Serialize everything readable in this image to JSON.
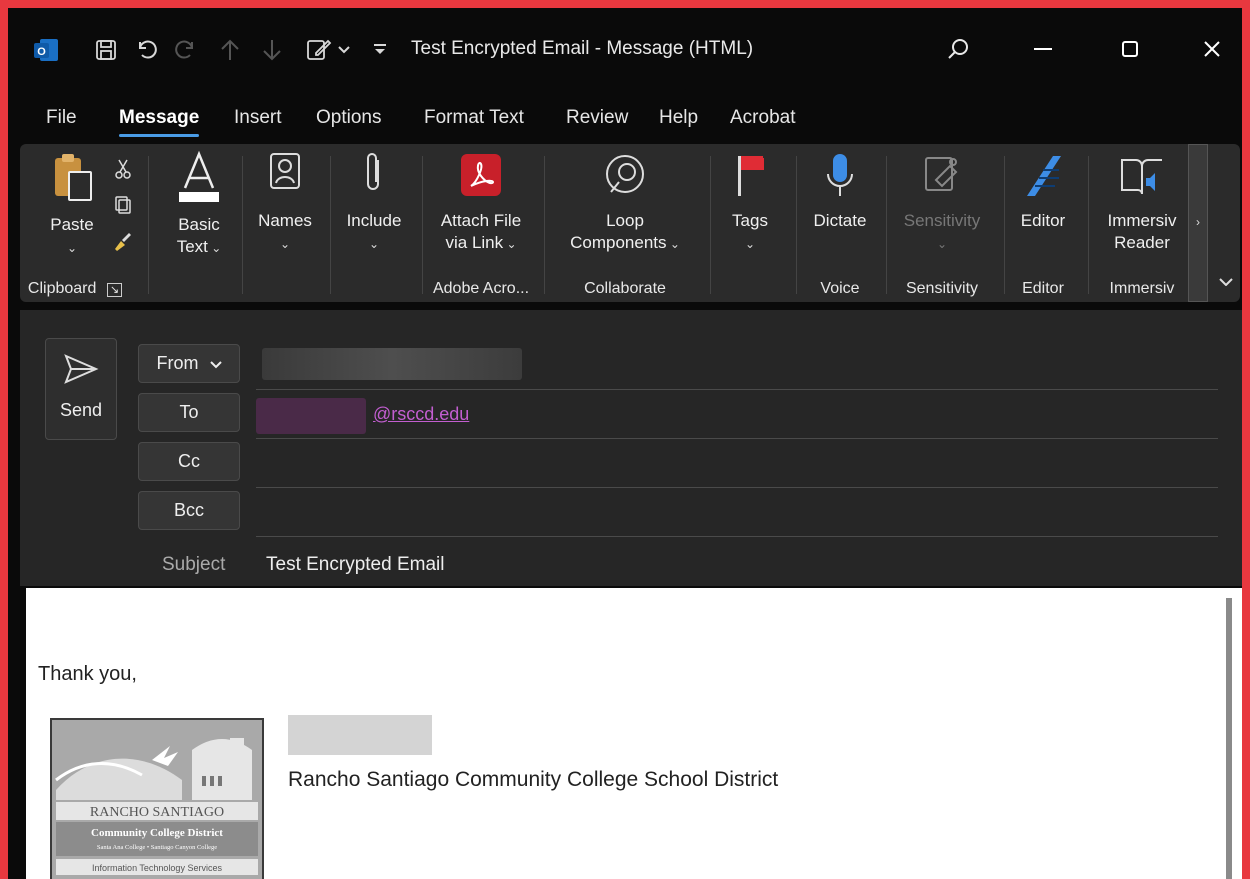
{
  "window": {
    "title": "Test Encrypted Email  -  Message (HTML)"
  },
  "menu": {
    "tabs": [
      "File",
      "Message",
      "Insert",
      "Options",
      "Format Text",
      "Review",
      "Help",
      "Acrobat"
    ],
    "active": "Message"
  },
  "ribbon": {
    "paste": "Paste",
    "basic_text_1": "Basic",
    "basic_text_2": "Text",
    "names": "Names",
    "include": "Include",
    "attach_1": "Attach File",
    "attach_2": "via Link",
    "loop_1": "Loop",
    "loop_2": "Components",
    "tags": "Tags",
    "dictate": "Dictate",
    "sensitivity": "Sensitivity",
    "editor": "Editor",
    "immersive_1": "Immersiv",
    "immersive_2": "Reader",
    "groups": {
      "clipboard": "Clipboard",
      "adobe": "Adobe Acro...",
      "collaborate": "Collaborate",
      "voice": "Voice",
      "sensitivity": "Sensitivity",
      "editor": "Editor",
      "immersive": "Immersiv"
    }
  },
  "compose": {
    "send": "Send",
    "from": "From",
    "to": "To",
    "cc": "Cc",
    "bcc": "Bcc",
    "to_value": "@rsccd.edu",
    "subject_label": "Subject",
    "subject_value": "Test Encrypted Email"
  },
  "body": {
    "greeting": "Thank you,",
    "organization": "Rancho Santiago Community College School District",
    "logo_text": {
      "line1": "RANCHO SANTIAGO",
      "line2": "Community College District",
      "line3": "Santa Ana College • Santiago Canyon College",
      "line4": "Information Technology Services"
    }
  },
  "colors": {
    "accent": "#4a9ce6",
    "frame": "#e8383f",
    "link": "#c25ed0"
  }
}
